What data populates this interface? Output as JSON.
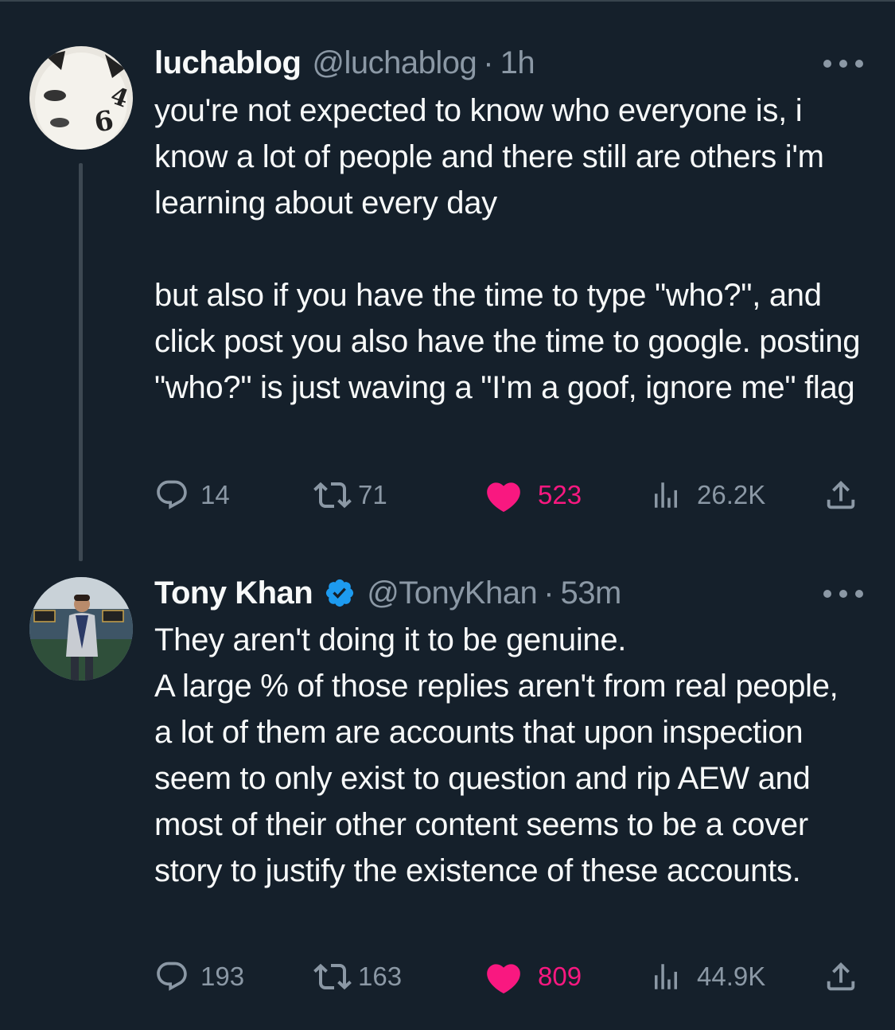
{
  "tweets": [
    {
      "name": "luchablog",
      "handle": "@luchablog",
      "separator": "·",
      "time": "1h",
      "verified": false,
      "paragraphs": [
        "you're not expected to know who everyone is, i know a lot of people and there still are others i'm learning about every day",
        "but also if you have the time to type \"who?\", and click post you also have the time to google. posting \"who?\" is just waving a \"I'm a goof, ignore me\" flag"
      ],
      "replies": "14",
      "reposts": "71",
      "likes": "523",
      "views": "26.2K",
      "liked": true
    },
    {
      "name": "Tony Khan",
      "handle": "@TonyKhan",
      "separator": "·",
      "time": "53m",
      "verified": true,
      "paragraphs": [
        "They aren't doing it to be genuine.",
        "A large % of those replies aren't from real people, a lot of them are accounts that upon inspection seem to only exist to question and rip AEW and most of their other content seems to be a cover story to justify the existence of these accounts."
      ],
      "replies": "193",
      "reposts": "163",
      "likes": "809",
      "views": "44.9K",
      "liked": true
    }
  ],
  "colors": {
    "background": "#15202b",
    "text": "#f7f9f9",
    "muted": "#8b98a5",
    "like": "#f91880",
    "verified": "#1d9bf0"
  },
  "icons": [
    "reply-icon",
    "repost-icon",
    "like-icon",
    "views-icon",
    "share-icon",
    "more-icon",
    "verified-badge-icon"
  ]
}
